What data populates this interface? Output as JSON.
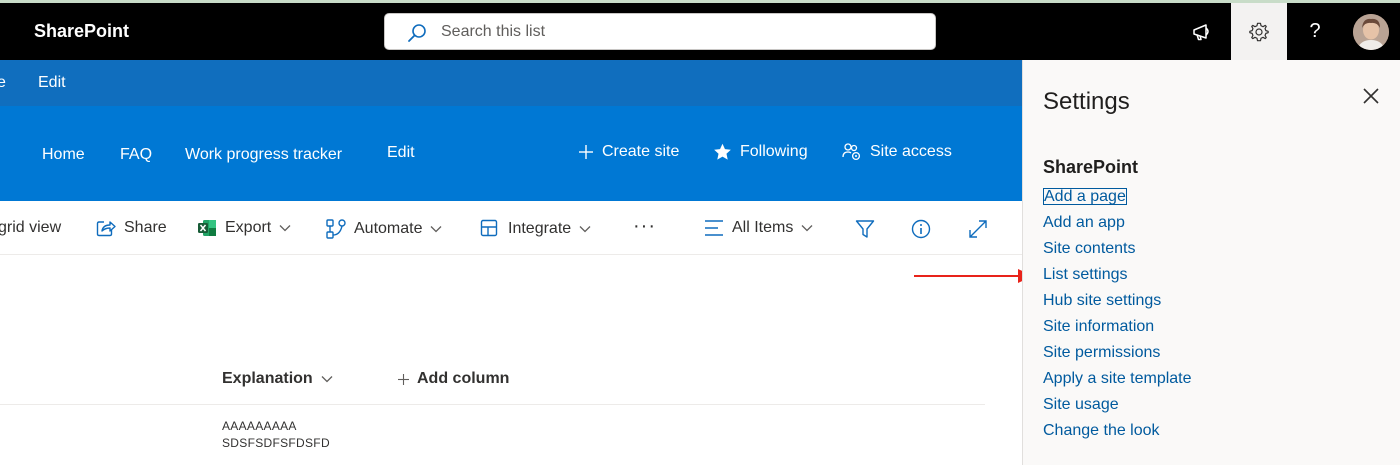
{
  "suitebar": {
    "brand": "SharePoint",
    "search_placeholder": "Search this list",
    "icons": [
      "search-icon",
      "megaphone-icon",
      "gear-icon",
      "help-icon"
    ],
    "help_label": "?"
  },
  "editbar": {
    "left_fragment": "e",
    "edit_label": "Edit"
  },
  "site_header": {
    "nav": [
      "Home",
      "FAQ",
      "Work progress tracker",
      "Edit"
    ],
    "create_site": "Create site",
    "following": "Following",
    "site_access": "Site access"
  },
  "commandbar": {
    "grid_view": "grid view",
    "share": "Share",
    "export": "Export",
    "automate": "Automate",
    "integrate": "Integrate",
    "more": "···",
    "view": "All Items"
  },
  "list": {
    "columns": [
      "Explanation",
      "Add column"
    ],
    "rows": [
      {
        "explanation_line1": "AAAAAAAAA",
        "explanation_line2": "SDSFSDFSFDSFD"
      }
    ]
  },
  "settings_panel": {
    "title": "Settings",
    "section": "SharePoint",
    "links": [
      "Add a page",
      "Add an app",
      "Site contents",
      "List settings",
      "Hub site settings",
      "Site information",
      "Site permissions",
      "Apply a site template",
      "Site usage",
      "Change the look"
    ]
  },
  "colors": {
    "suitebar": "#000000",
    "editbar": "#106ebe",
    "header": "#0078d4",
    "link": "#005a9e",
    "annotation_arrow": "#e8231a"
  }
}
